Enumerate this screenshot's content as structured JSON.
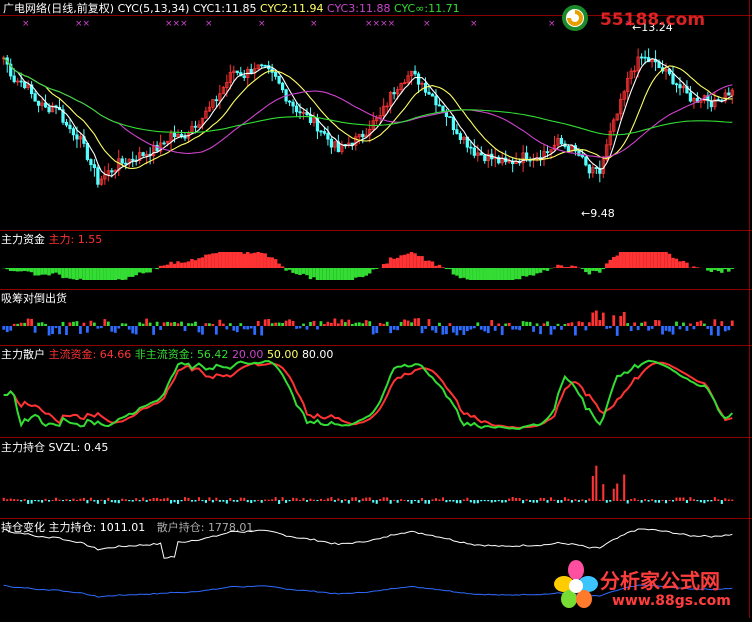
{
  "header": {
    "stock": "广电网络(日线,前复权)",
    "ind": "CYC(5,13,34)",
    "cyc1_label": "CYC1:",
    "cyc1_value": "11.85",
    "cyc2_label": "CYC2:",
    "cyc2_value": "11.94",
    "cyc3_label": "CYC3:",
    "cyc3_value": "11.88",
    "cycinf_label": "CYC∞:",
    "cycinf_value": "11.71"
  },
  "panels": {
    "p2": {
      "title": "主力资金",
      "label": "主力:",
      "value": "1.55"
    },
    "p3": {
      "title": "吸筹对倒出货"
    },
    "p4": {
      "title": "主力散户",
      "main_label": "主流资金:",
      "main_value": "64.66",
      "non_label": "非主流资金:",
      "non_value": "56.42",
      "lv1": "20.00",
      "lv2": "50.00",
      "lv3": "80.00"
    },
    "p5": {
      "title": "主力持仓",
      "label": "SVZL:",
      "value": "0.45"
    },
    "p6": {
      "title": "持仓变化",
      "main_label": "主力持仓:",
      "main_value": "1011.01",
      "retail_label": "散户持仓:",
      "retail_value": "1778.01"
    }
  },
  "annotations": {
    "high": "13.24",
    "low": "9.48"
  },
  "watermark": {
    "top": "55188.com",
    "brand": "分析家公式网",
    "url": "www.88gs.com"
  },
  "colors": {
    "up": "#ff3333",
    "down": "#54ffff",
    "green": "#33dd33",
    "blue": "#2f6bff",
    "purple": "#cc44cc",
    "white": "#ffffff",
    "yellow": "#ffff00",
    "grid": "#8b0000"
  },
  "chart_data": {
    "type": "candlestick",
    "price_range": [
      9.2,
      13.6
    ],
    "high": 13.24,
    "low": 9.48,
    "last": {
      "cyc1": 11.85,
      "cyc2": 11.94,
      "cyc3": 11.88,
      "cyc_inf": 11.71,
      "main_force": 1.55,
      "main_fund": 64.66,
      "non_main_fund": 56.42,
      "svzl": 0.45,
      "main_hold": 1011.01,
      "retail_hold": 1778.01
    },
    "levels_pct": [
      20,
      50,
      80
    ],
    "close_path": [
      [
        0,
        12.9
      ],
      [
        3,
        12.4
      ],
      [
        6,
        12.3
      ],
      [
        9,
        11.9
      ],
      [
        12,
        11.7
      ],
      [
        15,
        11.8
      ],
      [
        18,
        11.3
      ],
      [
        21,
        11.1
      ],
      [
        24,
        10.6
      ],
      [
        27,
        10.0
      ],
      [
        30,
        10.2
      ],
      [
        33,
        10.4
      ],
      [
        36,
        10.5
      ],
      [
        39,
        10.6
      ],
      [
        42,
        10.7
      ],
      [
        45,
        10.8
      ],
      [
        48,
        11.1
      ],
      [
        51,
        11.0
      ],
      [
        54,
        11.3
      ],
      [
        57,
        11.5
      ],
      [
        60,
        11.8
      ],
      [
        63,
        12.2
      ],
      [
        66,
        12.6
      ],
      [
        69,
        12.5
      ],
      [
        72,
        12.7
      ],
      [
        75,
        12.6
      ],
      [
        78,
        12.4
      ],
      [
        81,
        12.0
      ],
      [
        84,
        11.7
      ],
      [
        87,
        11.5
      ],
      [
        90,
        11.3
      ],
      [
        93,
        11.0
      ],
      [
        96,
        10.7
      ],
      [
        99,
        10.9
      ],
      [
        102,
        11.0
      ],
      [
        105,
        11.3
      ],
      [
        108,
        11.5
      ],
      [
        111,
        12.0
      ],
      [
        114,
        12.4
      ],
      [
        117,
        12.5
      ],
      [
        120,
        12.3
      ],
      [
        123,
        12.0
      ],
      [
        126,
        11.7
      ],
      [
        129,
        11.3
      ],
      [
        132,
        11.0
      ],
      [
        135,
        10.7
      ],
      [
        138,
        10.6
      ],
      [
        141,
        10.5
      ],
      [
        144,
        10.4
      ],
      [
        147,
        10.5
      ],
      [
        150,
        10.6
      ],
      [
        153,
        10.6
      ],
      [
        156,
        10.7
      ],
      [
        159,
        10.9
      ],
      [
        162,
        10.8
      ],
      [
        165,
        10.6
      ],
      [
        168,
        10.2
      ],
      [
        171,
        10.2
      ],
      [
        174,
        11.1
      ],
      [
        177,
        11.8
      ],
      [
        180,
        12.6
      ],
      [
        183,
        12.9
      ],
      [
        186,
        12.8
      ],
      [
        189,
        12.6
      ],
      [
        192,
        12.4
      ],
      [
        195,
        12.1
      ],
      [
        198,
        11.9
      ],
      [
        201,
        12.0
      ],
      [
        204,
        11.8
      ],
      [
        207,
        12.1
      ]
    ]
  }
}
